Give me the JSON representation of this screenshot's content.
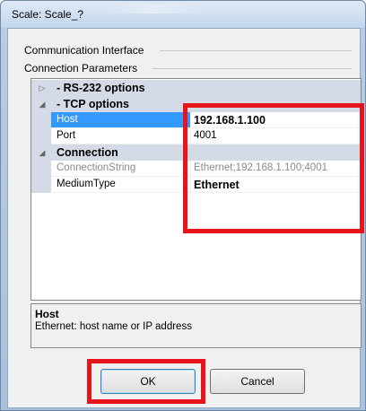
{
  "window": {
    "title": "Scale: Scale_?"
  },
  "sections": {
    "communication_interface": "Communication Interface",
    "connection_parameters": "Connection Parameters"
  },
  "grid": {
    "categories": {
      "rs232": {
        "label": "- RS-232 options",
        "expander": "▷",
        "expanded": false
      },
      "tcp": {
        "label": "- TCP options",
        "expander": "◢",
        "expanded": true
      },
      "connection": {
        "label": "Connection",
        "expander": "◢",
        "expanded": true
      }
    },
    "properties": {
      "host": {
        "name": "Host",
        "value": "192.168.1.100"
      },
      "port": {
        "name": "Port",
        "value": "4001"
      },
      "connection_string": {
        "name": "ConnectionString",
        "value": "Ethernet;192.168.1.100;4001"
      },
      "medium_type": {
        "name": "MediumType",
        "value": "Ethernet"
      }
    }
  },
  "help": {
    "title": "Host",
    "description": "Ethernet: host name or IP address"
  },
  "buttons": {
    "ok": "OK",
    "cancel": "Cancel"
  },
  "colors": {
    "highlight": "#e8141c",
    "selection": "#3399ff",
    "category_band": "#d4dbe7"
  }
}
